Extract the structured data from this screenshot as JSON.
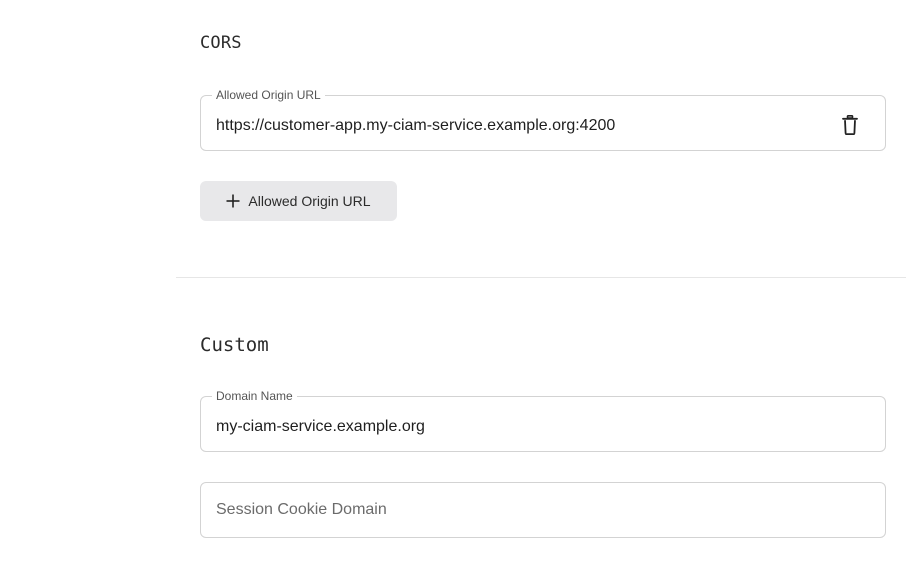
{
  "cors": {
    "title": "CORS",
    "allowed_origin": {
      "label": "Allowed Origin URL",
      "value": "https://customer-app.my-ciam-service.example.org:4200",
      "delete_icon": "trash-icon"
    },
    "add_button": {
      "label": "Allowed Origin URL",
      "icon": "plus-icon"
    }
  },
  "custom": {
    "title": "Custom",
    "domain_name": {
      "label": "Domain Name",
      "value": "my-ciam-service.example.org"
    },
    "session_cookie_domain": {
      "placeholder": "Session Cookie Domain"
    }
  },
  "colors": {
    "field_border": "#d3d3d3",
    "button_bg": "#e8e8ea",
    "divider": "#e6e6e6"
  }
}
